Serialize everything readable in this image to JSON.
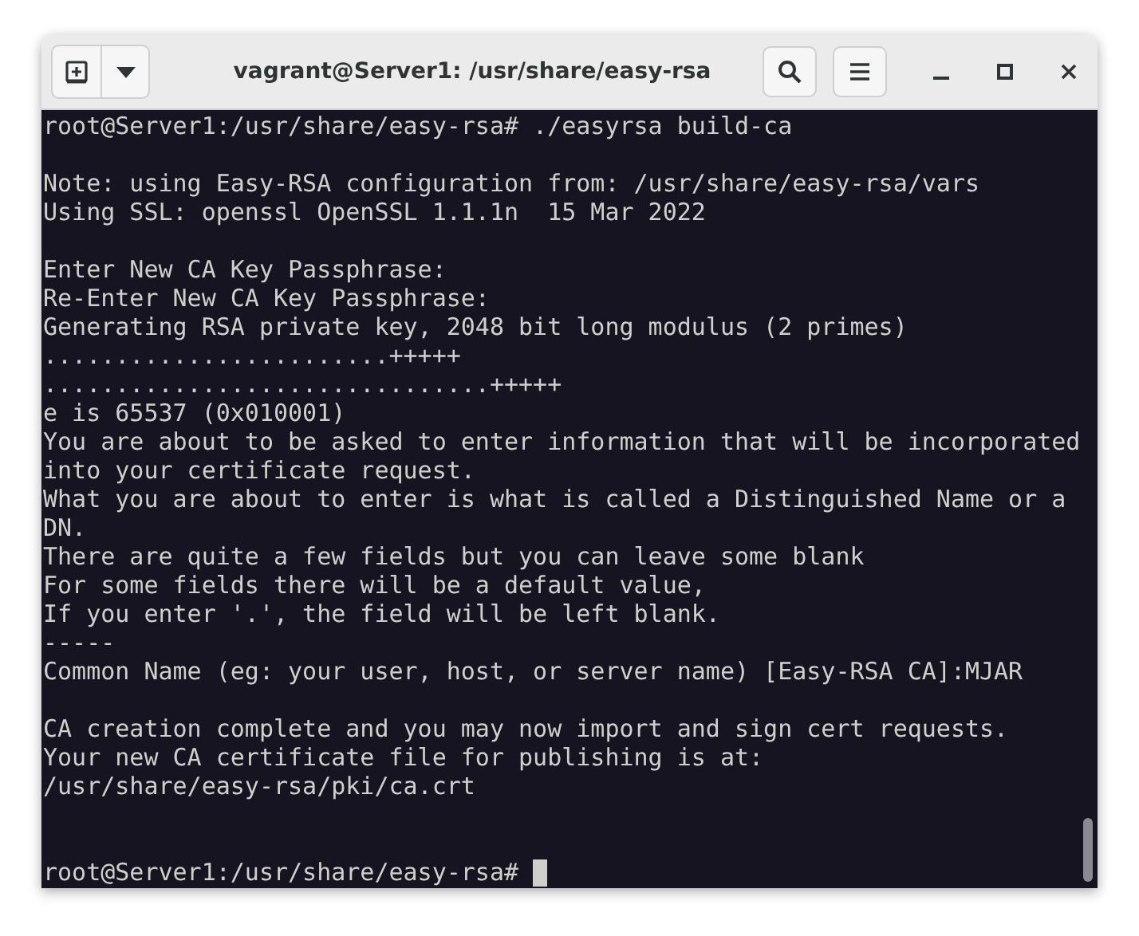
{
  "window": {
    "title": "vagrant@Server1: /usr/share/easy-rsa"
  },
  "terminal": {
    "lines": [
      {
        "kind": "output",
        "text": "root@Server1:/usr/share/easy-rsa# ./easyrsa build-ca"
      },
      {
        "kind": "blank"
      },
      {
        "kind": "output",
        "text": "Note: using Easy-RSA configuration from: /usr/share/easy-rsa/vars"
      },
      {
        "kind": "output",
        "text": "Using SSL: openssl OpenSSL 1.1.1n  15 Mar 2022"
      },
      {
        "kind": "blank"
      },
      {
        "kind": "output",
        "text": "Enter New CA Key Passphrase:"
      },
      {
        "kind": "output",
        "text": "Re-Enter New CA Key Passphrase:"
      },
      {
        "kind": "output",
        "text": "Generating RSA private key, 2048 bit long modulus (2 primes)"
      },
      {
        "kind": "output",
        "text": "........................+++++"
      },
      {
        "kind": "output",
        "text": "...............................+++++"
      },
      {
        "kind": "output",
        "text": "e is 65537 (0x010001)"
      },
      {
        "kind": "output",
        "text": "You are about to be asked to enter information that will be incorporated"
      },
      {
        "kind": "output",
        "text": "into your certificate request."
      },
      {
        "kind": "output",
        "text": "What you are about to enter is what is called a Distinguished Name or a"
      },
      {
        "kind": "output",
        "text": "DN."
      },
      {
        "kind": "output",
        "text": "There are quite a few fields but you can leave some blank"
      },
      {
        "kind": "output",
        "text": "For some fields there will be a default value,"
      },
      {
        "kind": "output",
        "text": "If you enter '.', the field will be left blank."
      },
      {
        "kind": "output",
        "text": "-----"
      },
      {
        "kind": "output",
        "text": "Common Name (eg: your user, host, or server name) [Easy-RSA CA]:MJAR"
      },
      {
        "kind": "blank"
      },
      {
        "kind": "output",
        "text": "CA creation complete and you may now import and sign cert requests."
      },
      {
        "kind": "output",
        "text": "Your new CA certificate file for publishing is at:"
      },
      {
        "kind": "output",
        "text": "/usr/share/easy-rsa/pki/ca.crt"
      },
      {
        "kind": "blank"
      },
      {
        "kind": "blank"
      },
      {
        "kind": "prompt",
        "text": "root@Server1:/usr/share/easy-rsa# "
      }
    ]
  }
}
